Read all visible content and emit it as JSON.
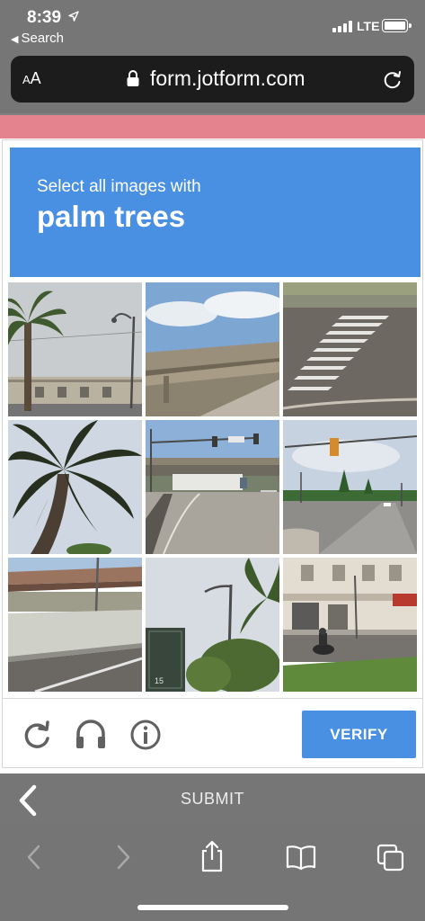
{
  "status_bar": {
    "time": "8:39",
    "back_app": "Search",
    "network": "LTE",
    "battery_level": 1.0
  },
  "browser": {
    "text_size_label_small": "A",
    "text_size_label_large": "A",
    "url": "form.jotform.com"
  },
  "captcha": {
    "prompt": "Select all images with",
    "target": "palm trees",
    "tiles": [
      {
        "scene": "palm tree and street lamp by warehouse"
      },
      {
        "scene": "highway overpass"
      },
      {
        "scene": "crosswalk on road"
      },
      {
        "scene": "palm tree fronds against sky"
      },
      {
        "scene": "intersection with traffic lights and truck"
      },
      {
        "scene": "intersection with traffic light"
      },
      {
        "scene": "overpass with concrete barrier"
      },
      {
        "scene": "street lamp with palm tree and sign"
      },
      {
        "scene": "street with building and motorcycle"
      }
    ],
    "verify_label": "VERIFY",
    "icons": [
      "reload-icon",
      "headphones-icon",
      "info-icon"
    ],
    "accent_color": "#4a90e2"
  },
  "form": {
    "submit_label": "SUBMIT",
    "band_color": "#e4838e"
  },
  "toolbar": {
    "icons": [
      "back-arrow-icon",
      "forward-arrow-icon",
      "share-icon",
      "bookmarks-icon",
      "tabs-icon"
    ]
  }
}
